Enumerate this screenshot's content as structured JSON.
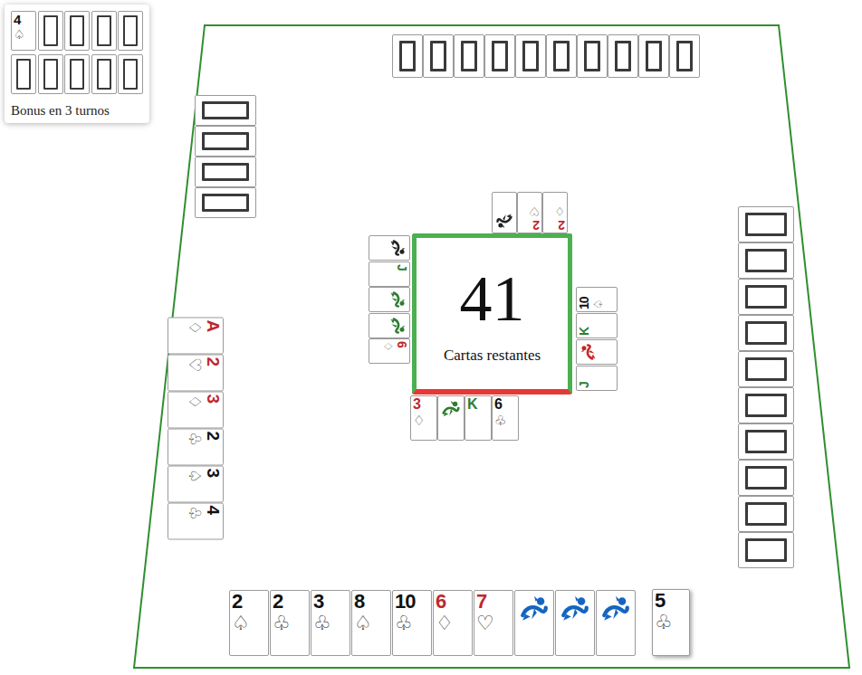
{
  "bonus": {
    "cards": [
      {
        "kind": "face",
        "rank": "4",
        "suit": "♤",
        "color": "#111111"
      },
      {
        "kind": "empty"
      },
      {
        "kind": "empty"
      },
      {
        "kind": "empty"
      },
      {
        "kind": "empty"
      },
      {
        "kind": "empty"
      },
      {
        "kind": "empty"
      },
      {
        "kind": "empty"
      },
      {
        "kind": "empty"
      },
      {
        "kind": "empty"
      }
    ],
    "label": "Bonus en 3 turnos"
  },
  "opponents": {
    "top": [
      {
        "kind": "back"
      },
      {
        "kind": "back"
      },
      {
        "kind": "back"
      },
      {
        "kind": "back"
      },
      {
        "kind": "back"
      },
      {
        "kind": "back"
      },
      {
        "kind": "back"
      },
      {
        "kind": "back"
      },
      {
        "kind": "back"
      },
      {
        "kind": "back"
      }
    ],
    "left": [
      {
        "kind": "back"
      },
      {
        "kind": "back"
      },
      {
        "kind": "back"
      },
      {
        "kind": "back"
      }
    ],
    "right": [
      {
        "kind": "back"
      },
      {
        "kind": "back"
      },
      {
        "kind": "back"
      },
      {
        "kind": "back"
      },
      {
        "kind": "back"
      },
      {
        "kind": "back"
      },
      {
        "kind": "back"
      },
      {
        "kind": "back"
      },
      {
        "kind": "back"
      },
      {
        "kind": "back"
      }
    ]
  },
  "deck": {
    "count": "41",
    "label": "Cartas restantes"
  },
  "melds": {
    "top": [
      {
        "kind": "joker",
        "color": "#222222"
      },
      {
        "kind": "face",
        "rank": "2",
        "suit": "♡",
        "color": "#c0282d"
      },
      {
        "kind": "face",
        "rank": "2",
        "suit": "♢",
        "color": "#c0282d"
      }
    ],
    "left": [
      {
        "kind": "joker",
        "color": "#222222"
      },
      {
        "kind": "face",
        "rank": "J",
        "color": "#2e7d32"
      },
      {
        "kind": "joker",
        "color": "#2e7d32"
      },
      {
        "kind": "joker",
        "color": "#2e7d32"
      },
      {
        "kind": "face",
        "rank": "6",
        "suit": "♢",
        "color": "#c0282d"
      }
    ],
    "right": [
      {
        "kind": "face",
        "rank": "10",
        "suit": "♤",
        "color": "#111111"
      },
      {
        "kind": "face",
        "rank": "K",
        "color": "#2e7d32"
      },
      {
        "kind": "joker",
        "color": "#c62828"
      },
      {
        "kind": "face",
        "rank": "J",
        "color": "#2e7d32"
      }
    ],
    "bottom": [
      {
        "kind": "face",
        "rank": "3",
        "suit": "♢",
        "color": "#c0282d"
      },
      {
        "kind": "joker",
        "color": "#2e7d32"
      },
      {
        "kind": "face",
        "rank": "K",
        "color": "#2e7d32"
      },
      {
        "kind": "face",
        "rank": "6",
        "suit": "♧",
        "color": "#111111"
      }
    ]
  },
  "side_meld": [
    {
      "kind": "face",
      "rank": "A",
      "suit": "♢",
      "color": "#c0282d"
    },
    {
      "kind": "face",
      "rank": "2",
      "suit": "♡",
      "color": "#c0282d"
    },
    {
      "kind": "face",
      "rank": "3",
      "suit": "♢",
      "color": "#c0282d"
    },
    {
      "kind": "face",
      "rank": "2",
      "suit": "♧",
      "color": "#111111"
    },
    {
      "kind": "face",
      "rank": "3",
      "suit": "♤",
      "color": "#111111"
    },
    {
      "kind": "face",
      "rank": "4",
      "suit": "♧",
      "color": "#111111"
    }
  ],
  "hand": [
    {
      "kind": "face",
      "rank": "2",
      "suit": "♤",
      "color": "#111111"
    },
    {
      "kind": "face",
      "rank": "2",
      "suit": "♧",
      "color": "#111111"
    },
    {
      "kind": "face",
      "rank": "3",
      "suit": "♧",
      "color": "#111111"
    },
    {
      "kind": "face",
      "rank": "8",
      "suit": "♤",
      "color": "#111111"
    },
    {
      "kind": "face",
      "rank": "10",
      "suit": "♧",
      "color": "#111111"
    },
    {
      "kind": "face",
      "rank": "6",
      "suit": "♢",
      "color": "#c0282d"
    },
    {
      "kind": "face",
      "rank": "7",
      "suit": "♡",
      "color": "#c0282d"
    },
    {
      "kind": "joker",
      "color": "#1565c0"
    },
    {
      "kind": "joker",
      "color": "#1565c0"
    },
    {
      "kind": "joker",
      "color": "#1565c0"
    }
  ],
  "drawn": {
    "kind": "face",
    "rank": "5",
    "suit": "♧",
    "color": "#111111"
  }
}
